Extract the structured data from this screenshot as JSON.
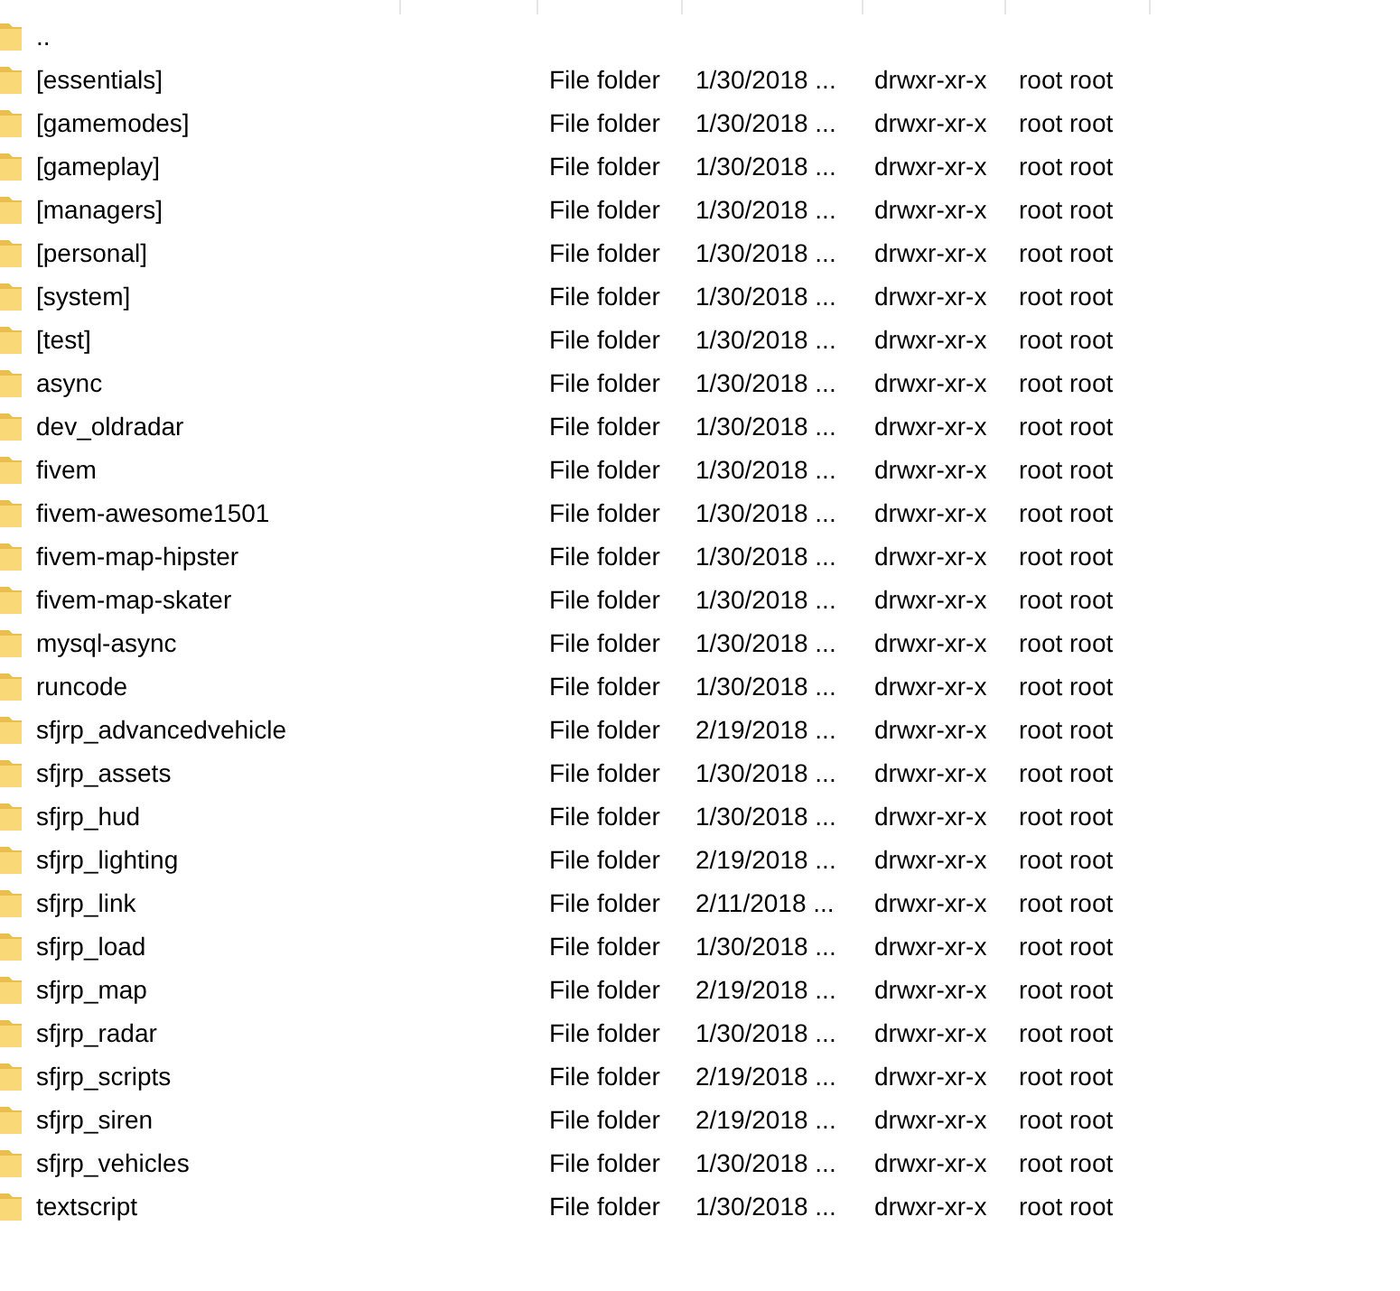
{
  "file_list": {
    "rows": [
      {
        "name": ".."
      },
      {
        "name": "[essentials]",
        "filetype": "File folder",
        "last_modified": "1/30/2018 ...",
        "permissions": "drwxr-xr-x",
        "owner": "root root"
      },
      {
        "name": "[gamemodes]",
        "filetype": "File folder",
        "last_modified": "1/30/2018 ...",
        "permissions": "drwxr-xr-x",
        "owner": "root root"
      },
      {
        "name": "[gameplay]",
        "filetype": "File folder",
        "last_modified": "1/30/2018 ...",
        "permissions": "drwxr-xr-x",
        "owner": "root root"
      },
      {
        "name": "[managers]",
        "filetype": "File folder",
        "last_modified": "1/30/2018 ...",
        "permissions": "drwxr-xr-x",
        "owner": "root root"
      },
      {
        "name": "[personal]",
        "filetype": "File folder",
        "last_modified": "1/30/2018 ...",
        "permissions": "drwxr-xr-x",
        "owner": "root root"
      },
      {
        "name": "[system]",
        "filetype": "File folder",
        "last_modified": "1/30/2018 ...",
        "permissions": "drwxr-xr-x",
        "owner": "root root"
      },
      {
        "name": "[test]",
        "filetype": "File folder",
        "last_modified": "1/30/2018 ...",
        "permissions": "drwxr-xr-x",
        "owner": "root root"
      },
      {
        "name": "async",
        "filetype": "File folder",
        "last_modified": "1/30/2018 ...",
        "permissions": "drwxr-xr-x",
        "owner": "root root"
      },
      {
        "name": "dev_oldradar",
        "filetype": "File folder",
        "last_modified": "1/30/2018 ...",
        "permissions": "drwxr-xr-x",
        "owner": "root root"
      },
      {
        "name": "fivem",
        "filetype": "File folder",
        "last_modified": "1/30/2018 ...",
        "permissions": "drwxr-xr-x",
        "owner": "root root"
      },
      {
        "name": "fivem-awesome1501",
        "filetype": "File folder",
        "last_modified": "1/30/2018 ...",
        "permissions": "drwxr-xr-x",
        "owner": "root root"
      },
      {
        "name": "fivem-map-hipster",
        "filetype": "File folder",
        "last_modified": "1/30/2018 ...",
        "permissions": "drwxr-xr-x",
        "owner": "root root"
      },
      {
        "name": "fivem-map-skater",
        "filetype": "File folder",
        "last_modified": "1/30/2018 ...",
        "permissions": "drwxr-xr-x",
        "owner": "root root"
      },
      {
        "name": "mysql-async",
        "filetype": "File folder",
        "last_modified": "1/30/2018 ...",
        "permissions": "drwxr-xr-x",
        "owner": "root root"
      },
      {
        "name": "runcode",
        "filetype": "File folder",
        "last_modified": "1/30/2018 ...",
        "permissions": "drwxr-xr-x",
        "owner": "root root"
      },
      {
        "name": "sfjrp_advancedvehicle",
        "filetype": "File folder",
        "last_modified": "2/19/2018 ...",
        "permissions": "drwxr-xr-x",
        "owner": "root root"
      },
      {
        "name": "sfjrp_assets",
        "filetype": "File folder",
        "last_modified": "1/30/2018 ...",
        "permissions": "drwxr-xr-x",
        "owner": "root root"
      },
      {
        "name": "sfjrp_hud",
        "filetype": "File folder",
        "last_modified": "1/30/2018 ...",
        "permissions": "drwxr-xr-x",
        "owner": "root root"
      },
      {
        "name": "sfjrp_lighting",
        "filetype": "File folder",
        "last_modified": "2/19/2018 ...",
        "permissions": "drwxr-xr-x",
        "owner": "root root"
      },
      {
        "name": "sfjrp_link",
        "filetype": "File folder",
        "last_modified": "2/11/2018 ...",
        "permissions": "drwxr-xr-x",
        "owner": "root root"
      },
      {
        "name": "sfjrp_load",
        "filetype": "File folder",
        "last_modified": "1/30/2018 ...",
        "permissions": "drwxr-xr-x",
        "owner": "root root"
      },
      {
        "name": "sfjrp_map",
        "filetype": "File folder",
        "last_modified": "2/19/2018 ...",
        "permissions": "drwxr-xr-x",
        "owner": "root root"
      },
      {
        "name": "sfjrp_radar",
        "filetype": "File folder",
        "last_modified": "1/30/2018 ...",
        "permissions": "drwxr-xr-x",
        "owner": "root root"
      },
      {
        "name": "sfjrp_scripts",
        "filetype": "File folder",
        "last_modified": "2/19/2018 ...",
        "permissions": "drwxr-xr-x",
        "owner": "root root"
      },
      {
        "name": "sfjrp_siren",
        "filetype": "File folder",
        "last_modified": "2/19/2018 ...",
        "permissions": "drwxr-xr-x",
        "owner": "root root"
      },
      {
        "name": "sfjrp_vehicles",
        "filetype": "File folder",
        "last_modified": "1/30/2018 ...",
        "permissions": "drwxr-xr-x",
        "owner": "root root"
      },
      {
        "name": "textscript",
        "filetype": "File folder",
        "last_modified": "1/30/2018 ...",
        "permissions": "drwxr-xr-x",
        "owner": "root root"
      }
    ]
  }
}
